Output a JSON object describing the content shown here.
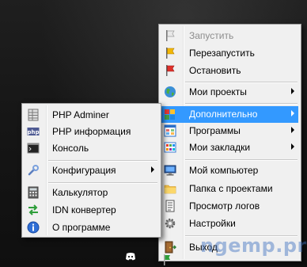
{
  "main_menu": {
    "items": [
      {
        "label": "Запустить",
        "icon": "white-flag-icon",
        "disabled": true
      },
      {
        "label": "Перезапустить",
        "icon": "yellow-flag-icon"
      },
      {
        "label": "Остановить",
        "icon": "red-flag-icon"
      },
      {
        "label": "Мои проекты",
        "icon": "globe-icon",
        "submenu": true
      },
      {
        "label": "Дополнительно",
        "icon": "blocks-icon",
        "submenu": true,
        "highlighted": true
      },
      {
        "label": "Программы",
        "icon": "window-grid-icon",
        "submenu": true
      },
      {
        "label": "Мои закладки",
        "icon": "bookmarks-icon",
        "submenu": true
      },
      {
        "label": "Мой компьютер",
        "icon": "computer-icon"
      },
      {
        "label": "Папка с проектами",
        "icon": "folder-icon"
      },
      {
        "label": "Просмотр логов",
        "icon": "log-icon"
      },
      {
        "label": "Настройки",
        "icon": "gear-icon"
      },
      {
        "label": "Выход",
        "icon": "exit-icon"
      }
    ]
  },
  "sub_menu": {
    "items": [
      {
        "label": "PHP Adminer",
        "icon": "table-icon"
      },
      {
        "label": "PHP информация",
        "icon": "php-icon"
      },
      {
        "label": "Консоль",
        "icon": "console-icon"
      },
      {
        "label": "Конфигурация",
        "icon": "wrench-icon",
        "submenu": true
      },
      {
        "label": "Калькулятор",
        "icon": "calculator-icon"
      },
      {
        "label": "IDN конвертер",
        "icon": "converter-icon"
      },
      {
        "label": "О программе",
        "icon": "info-icon"
      }
    ]
  },
  "watermark": "ngemp.pro",
  "colors": {
    "highlight": "#3399ff",
    "menu_bg": "#f0f0f0",
    "disabled_text": "#8d8d8d"
  }
}
